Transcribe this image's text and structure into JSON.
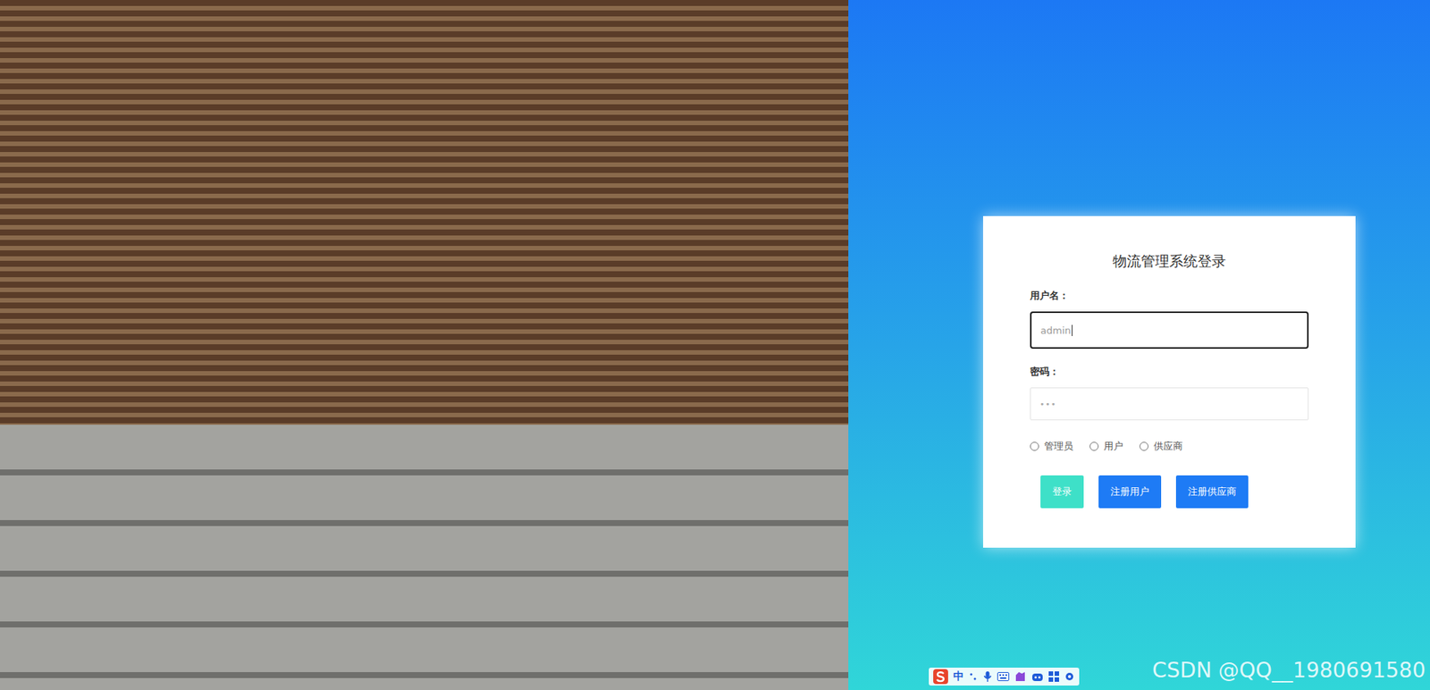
{
  "login": {
    "title": "物流管理系统登录",
    "fields": [
      {
        "label": "用户名：",
        "value": "admin",
        "kind": "text",
        "focused": true
      },
      {
        "label": "密码：",
        "value": "•••",
        "kind": "password",
        "focused": false
      }
    ],
    "roles": [
      {
        "label": "管理员",
        "selected": false
      },
      {
        "label": "用户",
        "selected": false
      },
      {
        "label": "供应商",
        "selected": false
      }
    ],
    "buttons": [
      {
        "label": "登录",
        "color": "#3ee0c8"
      },
      {
        "label": "注册用户",
        "color": "#1e7bf5"
      },
      {
        "label": "注册供应商",
        "color": "#1e7bf5"
      }
    ]
  },
  "ime_toolbar": {
    "mode": "中"
  },
  "watermark": "CSDN @QQ__1980691580"
}
